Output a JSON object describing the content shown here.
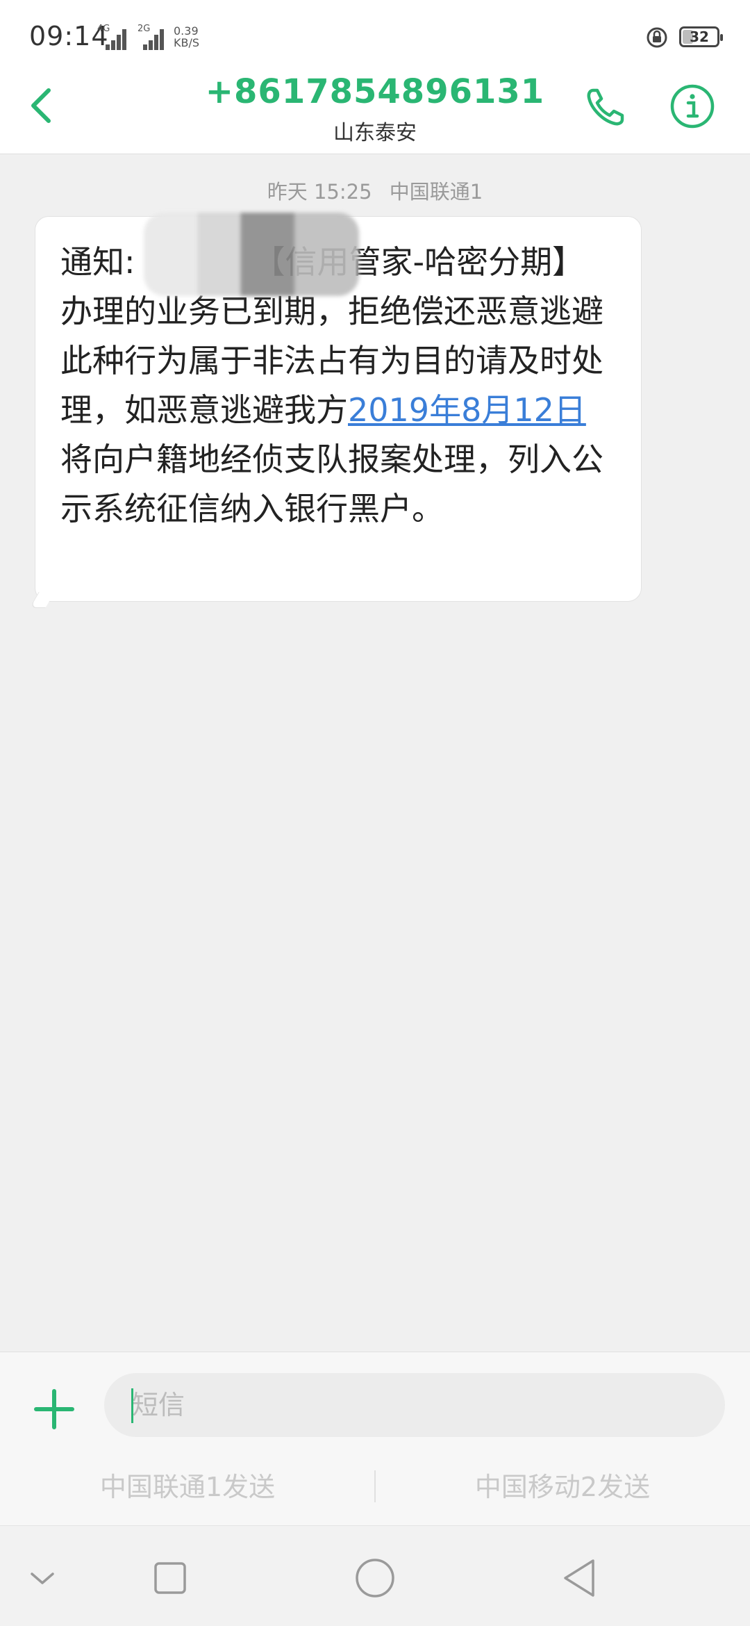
{
  "status_bar": {
    "time": "09:14",
    "sim1_tag": "4G",
    "sim2_tag": "2G",
    "speed_value": "0.39",
    "speed_unit": "KB/S",
    "battery_level": "32",
    "battery_fraction": 0.32
  },
  "header": {
    "contact_number": "+8617854896131",
    "contact_location": "山东泰安",
    "back_icon": "chevron-left-icon",
    "call_icon": "phone-icon",
    "info_icon": "info-icon",
    "accent_color": "#2ab673"
  },
  "conversation": {
    "messages": [
      {
        "timestamp": "昨天 15:25",
        "carrier": "中国联通1",
        "text_prefix": "通知:",
        "text_after_redaction": "【信用管家-哈密分期】办理的业务已到期，拒绝偿还恶意逃避此种行为属于非法占有为目的请及时处理，如恶意逃避我方",
        "date_link": "2019年8月12日",
        "text_suffix": "将向户籍地经侦支队报案处理，列入公示系统征信纳入银行黑户。",
        "link_color": "#3a7ed8"
      }
    ]
  },
  "composer": {
    "placeholder": "短信",
    "value": "",
    "add_icon": "plus-icon",
    "send_sim1_label": "中国联通1发送",
    "send_sim2_label": "中国移动2发送"
  },
  "nav_bar": {
    "icons": [
      "chevron-down-icon",
      "square-icon",
      "circle-icon",
      "triangle-back-icon"
    ]
  }
}
